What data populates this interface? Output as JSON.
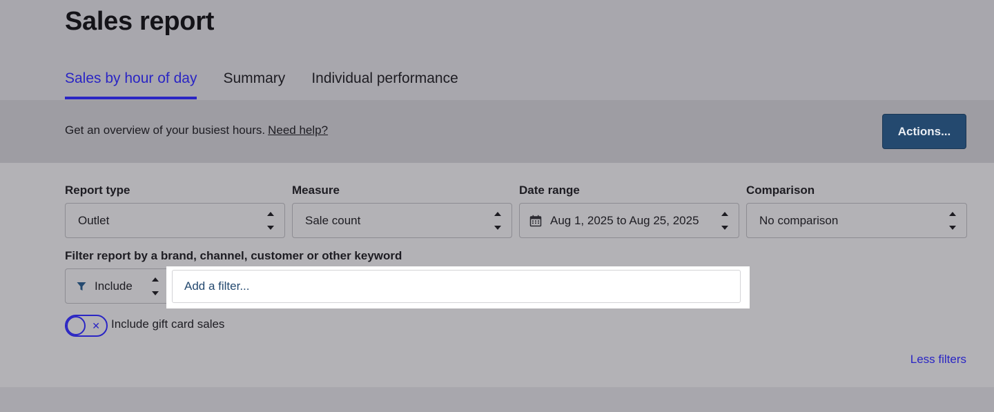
{
  "page": {
    "title": "Sales report"
  },
  "tabs": [
    {
      "label": "Sales by hour of day",
      "active": true
    },
    {
      "label": "Summary",
      "active": false
    },
    {
      "label": "Individual performance",
      "active": false
    }
  ],
  "info": {
    "text": "Get an overview of your busiest hours.",
    "help_link": "Need help?",
    "actions_label": "Actions..."
  },
  "filters": {
    "report_type": {
      "label": "Report type",
      "value": "Outlet"
    },
    "measure": {
      "label": "Measure",
      "value": "Sale count"
    },
    "date_range": {
      "label": "Date range",
      "value": "Aug 1, 2025 to Aug 25, 2025",
      "icon": "calendar-icon"
    },
    "comparison": {
      "label": "Comparison",
      "value": "No comparison"
    },
    "keyword": {
      "label": "Filter report by a brand, channel, customer or other keyword",
      "mode": "Include",
      "mode_icon": "funnel-icon",
      "placeholder": "Add a filter..."
    },
    "gift_card": {
      "label": "Include gift card sales",
      "enabled": false
    },
    "less_filters": "Less filters"
  },
  "colors": {
    "accent": "#2a25c4",
    "primary_button": "#24496f",
    "background": "#a8a7ad"
  }
}
